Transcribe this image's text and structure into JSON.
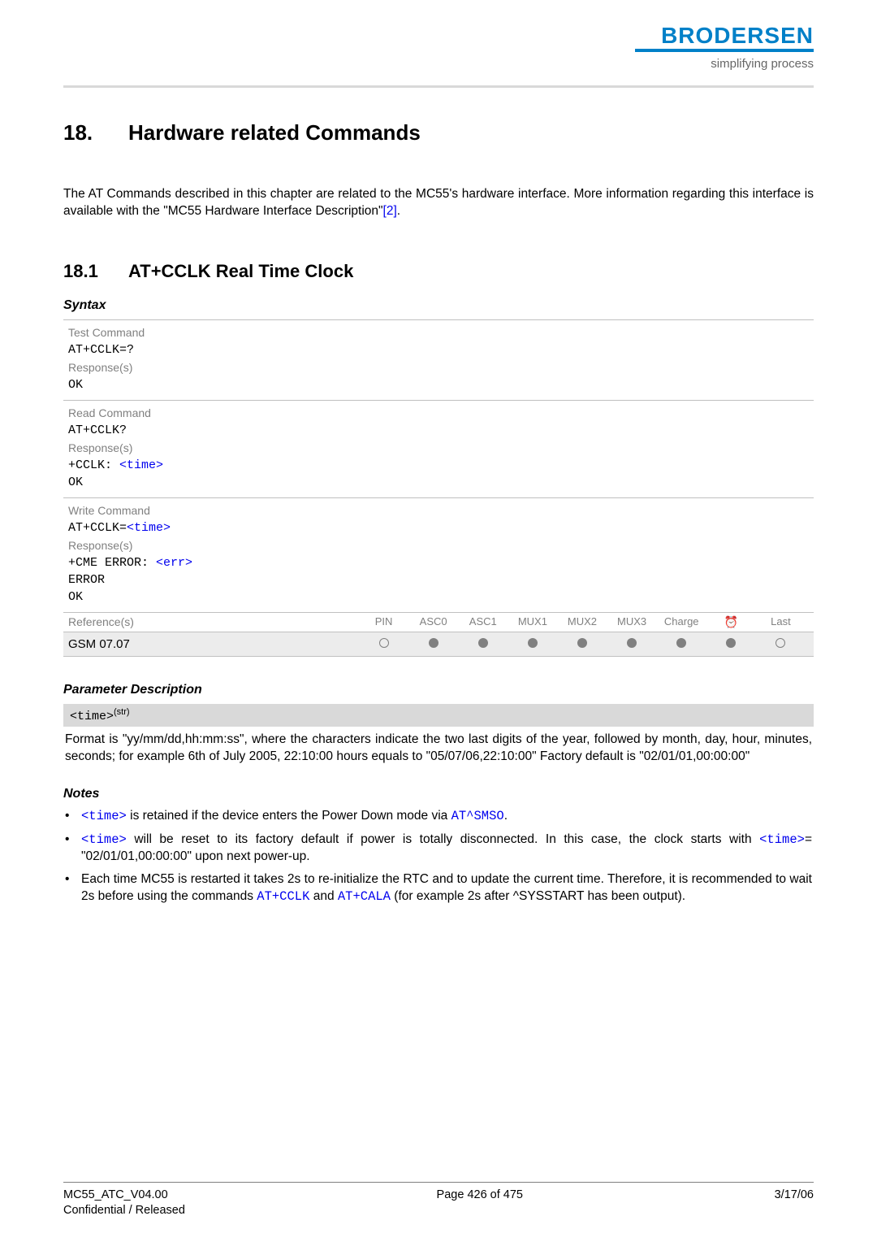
{
  "header": {
    "logo": "BRODERSEN",
    "tagline": "simplifying process"
  },
  "chapter": {
    "num": "18.",
    "title": "Hardware related Commands"
  },
  "intro": {
    "text_before_link": "The AT Commands described in this chapter are related to the MC55's hardware interface. More information regarding this interface is available with the \"MC55 Hardware Interface Description\"",
    "link": "[2]",
    "text_after_link": "."
  },
  "section": {
    "num": "18.1",
    "title": "AT+CCLK   Real Time Clock"
  },
  "syntax_label": "Syntax",
  "blocks": {
    "test": {
      "label": "Test Command",
      "cmd": "AT+CCLK=?",
      "resp_label": "Response(s)",
      "resp": "OK"
    },
    "read": {
      "label": "Read Command",
      "cmd": "AT+CCLK?",
      "resp_label": "Response(s)",
      "resp_prefix": "+CCLK: ",
      "resp_param": "<time>",
      "resp2": "OK"
    },
    "write": {
      "label": "Write Command",
      "cmd_prefix": "AT+CCLK=",
      "cmd_param": "<time>",
      "resp_label": "Response(s)",
      "resp1_prefix": "+CME ERROR: ",
      "resp1_param": "<err>",
      "resp2": "ERROR",
      "resp3": "OK"
    }
  },
  "ref": {
    "label": "Reference(s)",
    "cols": [
      "PIN",
      "ASC0",
      "ASC1",
      "MUX1",
      "MUX2",
      "MUX3",
      "Charge",
      "alarm",
      "Last"
    ],
    "row_label": "GSM 07.07",
    "row_states": [
      "empty",
      "filled",
      "filled",
      "filled",
      "filled",
      "filled",
      "filled",
      "filled",
      "empty"
    ]
  },
  "param_section": {
    "heading": "Parameter Description",
    "header_text": "<time>",
    "header_sup": "(str)",
    "body": "Format is \"yy/mm/dd,hh:mm:ss\", where the characters indicate the two last digits of the year, followed by month, day, hour, minutes, seconds; for example 6th of July 2005, 22:10:00 hours equals to \"05/07/06,22:10:00\" Factory default is \"02/01/01,00:00:00\""
  },
  "notes": {
    "heading": "Notes",
    "items": [
      {
        "parts": [
          {
            "type": "param",
            "text": "<time>"
          },
          {
            "type": "plain",
            "text": " is retained if the device enters the Power Down mode via "
          },
          {
            "type": "param",
            "text": "AT^SMSO"
          },
          {
            "type": "plain",
            "text": "."
          }
        ]
      },
      {
        "parts": [
          {
            "type": "param",
            "text": "<time>"
          },
          {
            "type": "plain",
            "text": " will be reset to its factory default if power is totally disconnected. In this case, the clock starts with "
          },
          {
            "type": "param",
            "text": "<time>"
          },
          {
            "type": "plain",
            "text": "= \"02/01/01,00:00:00\" upon next power-up."
          }
        ]
      },
      {
        "parts": [
          {
            "type": "plain",
            "text": "Each time MC55 is restarted it takes 2s to re-initialize the RTC and to update the current time. Therefore, it is recommended to wait 2s before using the commands "
          },
          {
            "type": "param",
            "text": "AT+CCLK"
          },
          {
            "type": "plain",
            "text": " and "
          },
          {
            "type": "param",
            "text": "AT+CALA"
          },
          {
            "type": "plain",
            "text": " (for example 2s after ^SYSSTART has been output)."
          }
        ]
      }
    ]
  },
  "footer": {
    "left1": "MC55_ATC_V04.00",
    "left2": "Confidential / Released",
    "center": "Page 426 of 475",
    "right": "3/17/06"
  }
}
